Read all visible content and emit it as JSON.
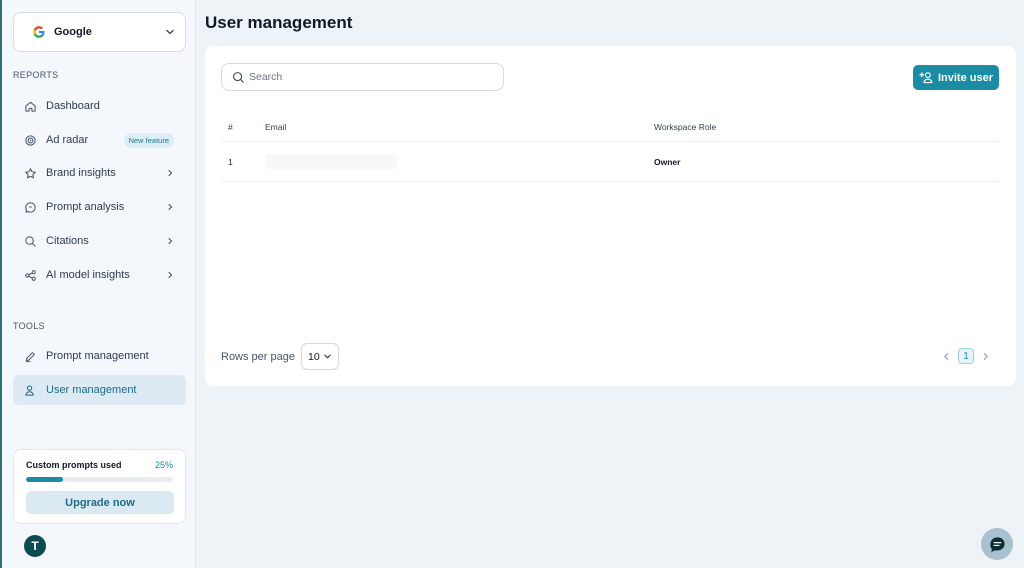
{
  "workspace": {
    "name": "Google"
  },
  "sidebar": {
    "reports_label": "REPORTS",
    "tools_label": "TOOLS",
    "reports": [
      {
        "label": "Dashboard",
        "icon": "home-icon"
      },
      {
        "label": "Ad radar",
        "icon": "radar-icon",
        "badge": "New feature"
      },
      {
        "label": "Brand insights",
        "icon": "star-icon"
      },
      {
        "label": "Prompt analysis",
        "icon": "chat-bubble-icon"
      },
      {
        "label": "Citations",
        "icon": "search-icon"
      },
      {
        "label": "AI model insights",
        "icon": "share-nodes-icon"
      }
    ],
    "tools": [
      {
        "label": "Prompt management",
        "icon": "pencil-icon"
      },
      {
        "label": "User management",
        "icon": "user-icon",
        "active": true
      }
    ]
  },
  "usage": {
    "title": "Custom prompts used",
    "percent_label": "25%",
    "progress": 0.25,
    "upgrade_label": "Upgrade now"
  },
  "user": {
    "avatar_initial": "T"
  },
  "page": {
    "title": "User management"
  },
  "toolbar": {
    "search_placeholder": "Search",
    "invite_label": "Invite user"
  },
  "table": {
    "columns": [
      "#",
      "Email",
      "Workspace Role"
    ],
    "rows": [
      {
        "num": "1",
        "email": "",
        "role": "Owner"
      }
    ]
  },
  "pagination": {
    "rows_per_page_label": "Rows per page",
    "rows_per_page_value": "10",
    "current_page": "1"
  },
  "colors": {
    "accent": "#1b8ca3",
    "active_bg": "#dde9f3",
    "page_bg": "#eef3f8"
  }
}
